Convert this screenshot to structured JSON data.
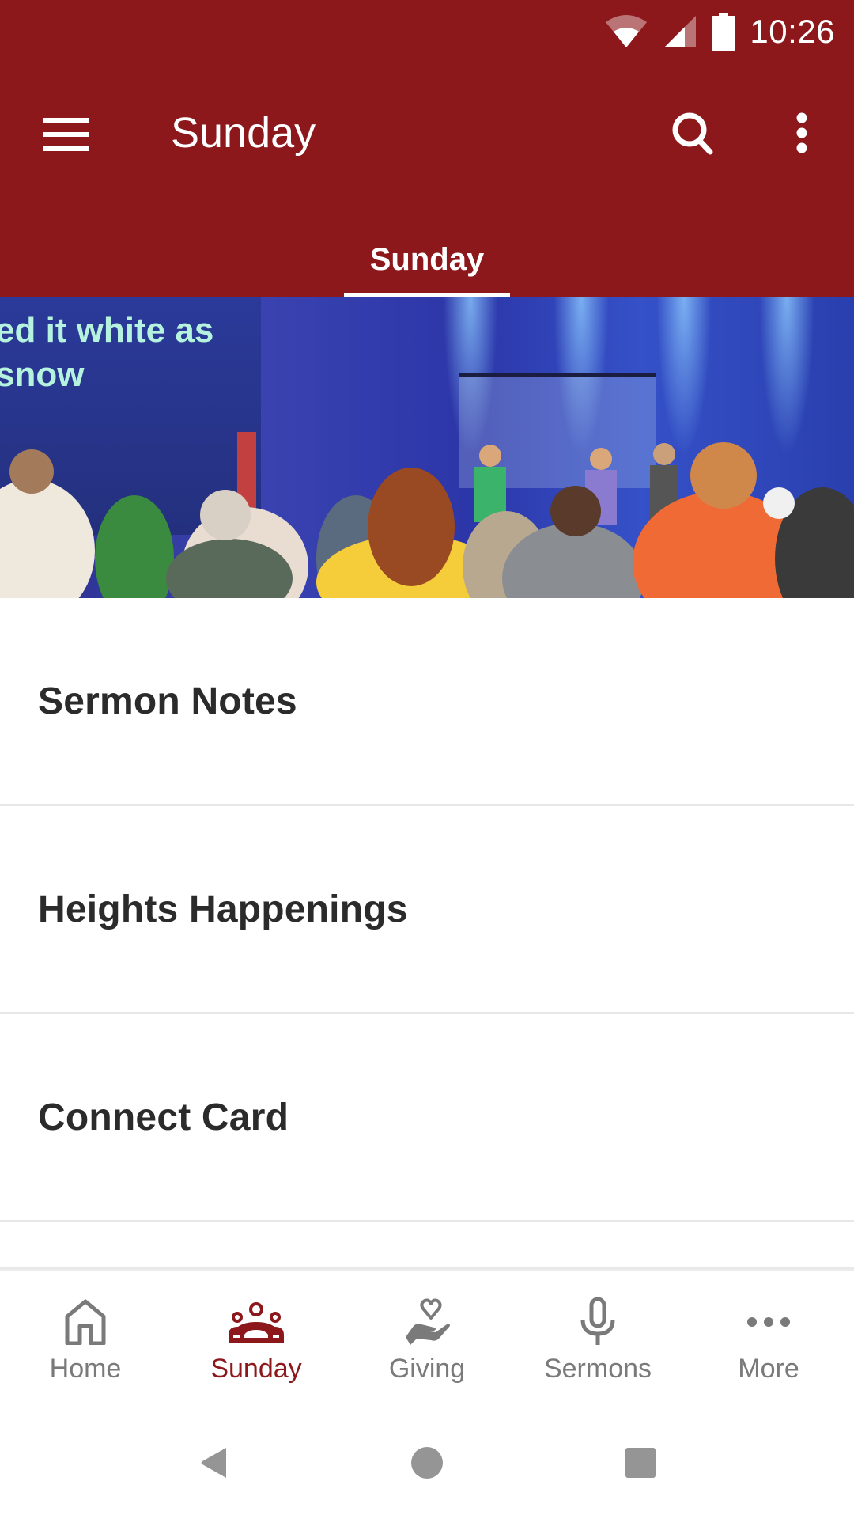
{
  "status_bar": {
    "time": "10:26",
    "icons": [
      "wifi-icon",
      "cell-signal-icon",
      "battery-icon"
    ]
  },
  "app_bar": {
    "title": "Sunday",
    "menu_icon": "hamburger-menu-icon",
    "search_icon": "search-icon",
    "overflow_icon": "more-vertical-icon"
  },
  "tabs": [
    {
      "label": "Sunday",
      "selected": true
    }
  ],
  "banner": {
    "lyrics_line1": "ed it white as",
    "lyrics_line2": "snow"
  },
  "list": {
    "items": [
      {
        "label": "Sermon Notes"
      },
      {
        "label": "Heights Happenings"
      },
      {
        "label": "Connect Card"
      }
    ]
  },
  "bottom_nav": {
    "items": [
      {
        "label": "Home",
        "icon": "home-icon",
        "active": false
      },
      {
        "label": "Sunday",
        "icon": "people-group-icon",
        "active": true
      },
      {
        "label": "Giving",
        "icon": "hand-heart-icon",
        "active": false
      },
      {
        "label": "Sermons",
        "icon": "microphone-icon",
        "active": false
      },
      {
        "label": "More",
        "icon": "more-horizontal-icon",
        "active": false
      }
    ]
  },
  "colors": {
    "brand": "#8c181c",
    "inactive": "#7a7a7a",
    "text": "#2b2b2b",
    "divider": "#e8e8e8"
  }
}
